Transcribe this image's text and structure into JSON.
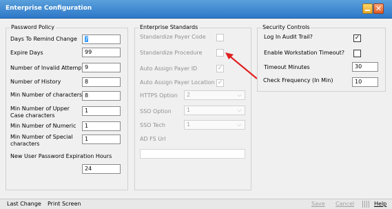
{
  "window": {
    "title": "Enterprise Configuration",
    "close_glyph": "✕"
  },
  "password_policy": {
    "legend": "Password Policy",
    "days_to_remind": {
      "label": "Days To Remind Change",
      "value": "7"
    },
    "expire_days": {
      "label": "Expire Days",
      "value": "99"
    },
    "invalid_attempts": {
      "label": "Number of Invalid Attempts",
      "value": "9"
    },
    "history": {
      "label": "Number of History",
      "value": "8"
    },
    "min_chars": {
      "label": "Min Number of characters",
      "value": "8"
    },
    "min_upper": {
      "label": "Min Number of Upper Case characters",
      "value": "1"
    },
    "min_numeric": {
      "label": "Min Number of Numeric",
      "value": "1"
    },
    "min_special": {
      "label": "Min Number of Special characters",
      "value": "1"
    },
    "new_user_exp": {
      "label": "New User Password Expiration Hours",
      "value": "24"
    }
  },
  "enterprise_standards": {
    "legend": "Enterprise Standards",
    "std_payer_code": {
      "label": "Standardize Payer Code",
      "checked": false
    },
    "std_procedure": {
      "label": "Standardize Procedure",
      "checked": false
    },
    "auto_payer_id": {
      "label": "Auto Assign Payer ID",
      "checked": true
    },
    "auto_payer_loc": {
      "label": "Auto Assign Payer Location",
      "checked": true
    },
    "https_option": {
      "label": "HTTPS Option",
      "value": "2"
    },
    "sso_option": {
      "label": "SSO Option",
      "value": "1"
    },
    "sso_tech": {
      "label": "SSO Tech",
      "value": "1"
    },
    "adfs_url": {
      "label": "AD FS Url",
      "value": ""
    },
    "check_glyph": "✓",
    "arrow_glyph": "⌵"
  },
  "security_controls": {
    "legend": "Security Controls",
    "audit_trail": {
      "label": "Log In Audit Trail?",
      "checked": true
    },
    "workstation_timeout": {
      "label": "Enable Workstation Timeout?",
      "checked": false
    },
    "timeout_minutes": {
      "label": "Timeout Minutes",
      "value": "30"
    },
    "check_frequency": {
      "label": "Check Frequency (In Min)",
      "value": "10"
    }
  },
  "statusbar": {
    "last_change": "Last Change",
    "print_screen": "Print Screen",
    "save": "Save",
    "cancel": "Cancel",
    "help": "Help"
  },
  "colors": {
    "annotation_arrow": "#e02020",
    "titlebar": "#3a84d0"
  }
}
